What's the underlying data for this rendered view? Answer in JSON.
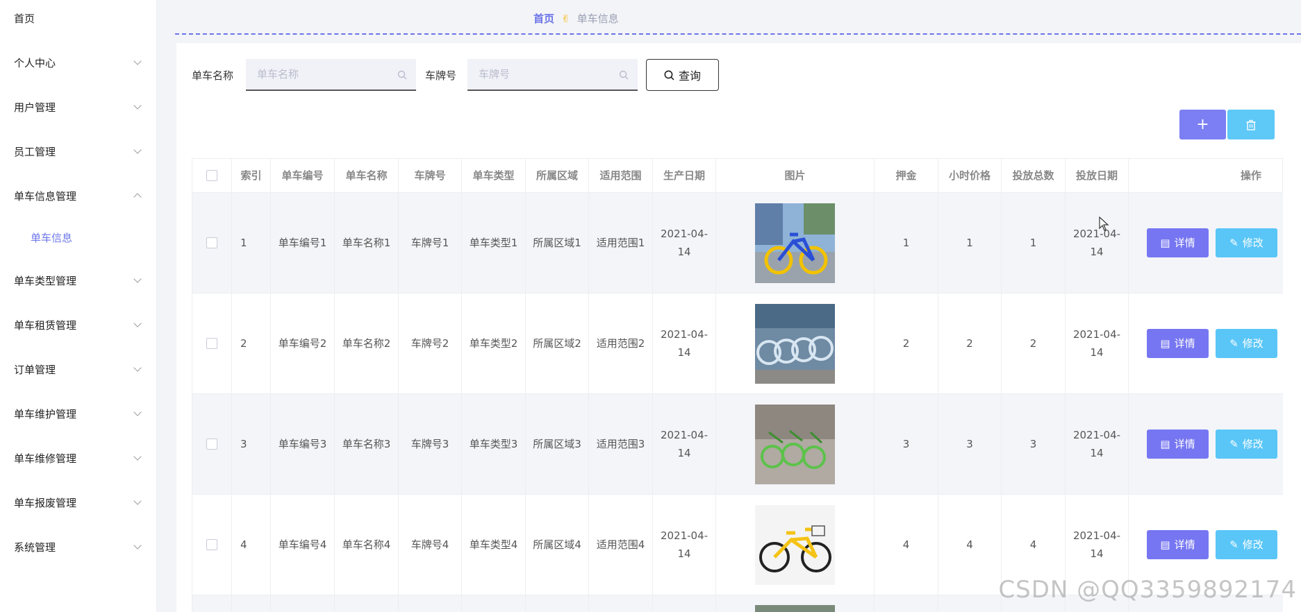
{
  "sidebar": {
    "items": [
      {
        "label": "首页",
        "has_chevron": false
      },
      {
        "label": "个人中心",
        "has_chevron": true
      },
      {
        "label": "用户管理",
        "has_chevron": true
      },
      {
        "label": "员工管理",
        "has_chevron": true
      },
      {
        "label": "单车信息管理",
        "has_chevron": true,
        "expanded": true
      },
      {
        "label": "单车类型管理",
        "has_chevron": true
      },
      {
        "label": "单车租赁管理",
        "has_chevron": true
      },
      {
        "label": "订单管理",
        "has_chevron": true
      },
      {
        "label": "单车维护管理",
        "has_chevron": true
      },
      {
        "label": "单车维修管理",
        "has_chevron": true
      },
      {
        "label": "单车报废管理",
        "has_chevron": true
      },
      {
        "label": "系统管理",
        "has_chevron": true
      }
    ],
    "submenu": {
      "label": "单车信息"
    }
  },
  "breadcrumb": {
    "home": "首页",
    "current": "单车信息",
    "separator_icon": "hand-icon"
  },
  "search": {
    "name_label": "单车名称",
    "name_placeholder": "单车名称",
    "plate_label": "车牌号",
    "plate_placeholder": "车牌号",
    "query_label": "查询"
  },
  "actions": {
    "add_symbol": "+",
    "delete_icon": "trash-icon"
  },
  "colors": {
    "accent": "#6b73e8",
    "detail_button": "#7676f2",
    "edit_button": "#59c6f7"
  },
  "table": {
    "columns": [
      "索引",
      "单车编号",
      "单车名称",
      "车牌号",
      "单车类型",
      "所属区域",
      "适用范围",
      "生产日期",
      "图片",
      "押金",
      "小时价格",
      "投放总数",
      "投放日期",
      "操作"
    ],
    "rows": [
      {
        "index": "1",
        "code": "单车编号1",
        "name": "单车名称1",
        "plate": "车牌号1",
        "type": "单车类型1",
        "area": "所属区域1",
        "scope": "适用范围1",
        "prod_date": "2021-04-14",
        "image": "blue-yellow-bike-photo",
        "deposit": "1",
        "price": "1",
        "total": "1",
        "release_date": "2021-04-14"
      },
      {
        "index": "2",
        "code": "单车编号2",
        "name": "单车名称2",
        "plate": "车牌号2",
        "type": "单车类型2",
        "area": "所属区域2",
        "scope": "适用范围2",
        "prod_date": "2021-04-14",
        "image": "parked-bikes-row-photo",
        "deposit": "2",
        "price": "2",
        "total": "2",
        "release_date": "2021-04-14"
      },
      {
        "index": "3",
        "code": "单车编号3",
        "name": "单车名称3",
        "plate": "车牌号3",
        "type": "单车类型3",
        "area": "所属区域3",
        "scope": "适用范围3",
        "prod_date": "2021-04-14",
        "image": "green-bikes-photo",
        "deposit": "3",
        "price": "3",
        "total": "3",
        "release_date": "2021-04-14"
      },
      {
        "index": "4",
        "code": "单车编号4",
        "name": "单车名称4",
        "plate": "车牌号4",
        "type": "单车类型4",
        "area": "所属区域4",
        "scope": "适用范围4",
        "prod_date": "2021-04-14",
        "image": "yellow-bike-photo",
        "deposit": "4",
        "price": "4",
        "total": "4",
        "release_date": "2021-04-14"
      }
    ],
    "detail_label": "详情",
    "edit_label": "修改"
  },
  "watermark": "CSDN @QQ3359892174"
}
